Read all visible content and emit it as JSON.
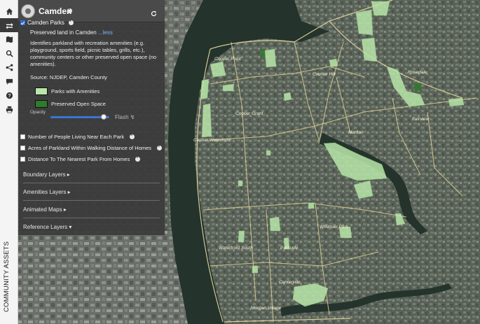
{
  "panel": {
    "title": "Camden",
    "layer": {
      "name": "Camden Parks",
      "checked": true,
      "short_description": "Preserved land in Camden",
      "more_link": "...less",
      "full_description": "Identifies parkland with recreation amenities (e.g. playground, sports field, picnic tables, grills, etc.), community centers or other preserved open space (no amenities).",
      "source": "Source: NJDEP, Camden County",
      "legend": [
        {
          "label": "Parks with Amenities",
          "color": "#b9e6a9"
        },
        {
          "label": "Preserved Open Space",
          "color": "#2f7a2c"
        }
      ],
      "opacity_label": "Opacity",
      "opacity": 0.9,
      "flash_label": "Flash"
    },
    "options": [
      {
        "label": "Number of People Living Near Each Park",
        "checked": false
      },
      {
        "label": "Acres of Parkland Within Walking Distance of Homes",
        "checked": false
      },
      {
        "label": "Distance To The Nearest Park From Homes",
        "checked": false
      }
    ],
    "sections": [
      {
        "label": "Boundary Layers",
        "expanded": false
      },
      {
        "label": "Amenities Layers",
        "expanded": false
      },
      {
        "label": "Animated Maps",
        "expanded": false
      },
      {
        "label": "Reference Layers",
        "expanded": true
      }
    ]
  },
  "rail": {
    "title": "COMMUNITY ASSETS",
    "buttons": [
      "home-icon",
      "swap-icon",
      "map-icon",
      "search-icon",
      "share-icon",
      "comment-icon",
      "help-icon",
      "print-icon"
    ]
  },
  "map": {
    "labels": [
      "Cooper Point",
      "Cramer Hill",
      "Rosedale",
      "Cooper Grant",
      "Marlton",
      "Central Waterfront",
      "Fairview",
      "Whitman Park",
      "Waterfront South",
      "Morgan Village",
      "Parkside",
      "Centerville"
    ]
  }
}
